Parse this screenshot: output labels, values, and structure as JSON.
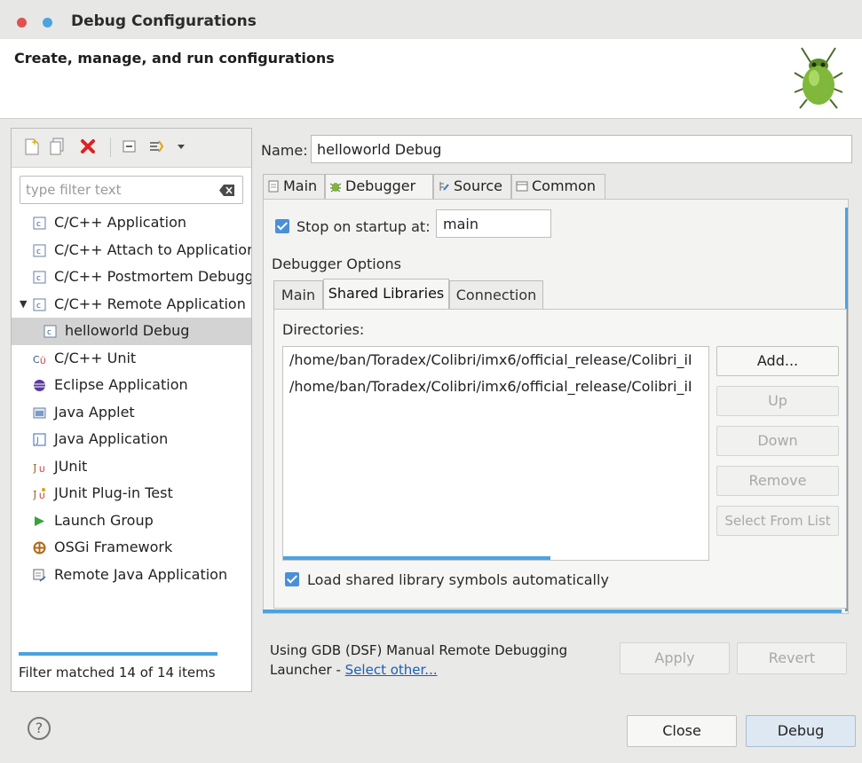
{
  "window": {
    "title": "Debug Configurations",
    "header": "Create, manage, and run configurations"
  },
  "toolbar": {
    "icons": [
      "new-config-icon",
      "duplicate-icon",
      "delete-icon",
      "collapse-all-icon",
      "filter-icon",
      "dropdown-icon"
    ]
  },
  "filter": {
    "placeholder": "type filter text",
    "status": "Filter matched 14 of 14 items"
  },
  "tree": [
    {
      "label": "C/C++ Application",
      "icon": "c-app-icon"
    },
    {
      "label": "C/C++ Attach to Applicatior",
      "icon": "c-app-icon"
    },
    {
      "label": "C/C++ Postmortem Debugg",
      "icon": "c-app-icon"
    },
    {
      "label": "C/C++ Remote Application",
      "icon": "c-app-icon",
      "expanded": true
    },
    {
      "label": "helloworld Debug",
      "icon": "c-app-icon",
      "child": true,
      "selected": true
    },
    {
      "label": "C/C++ Unit",
      "icon": "c-unit-icon"
    },
    {
      "label": "Eclipse Application",
      "icon": "eclipse-icon"
    },
    {
      "label": "Java Applet",
      "icon": "java-applet-icon"
    },
    {
      "label": "Java Application",
      "icon": "java-app-icon"
    },
    {
      "label": "JUnit",
      "icon": "junit-icon"
    },
    {
      "label": "JUnit Plug-in Test",
      "icon": "junit-plugin-icon"
    },
    {
      "label": "Launch Group",
      "icon": "launch-group-icon"
    },
    {
      "label": "OSGi Framework",
      "icon": "osgi-icon"
    },
    {
      "label": "Remote Java Application",
      "icon": "remote-java-icon"
    }
  ],
  "config": {
    "name_label": "Name:",
    "name_value": "helloworld Debug",
    "tabs": [
      {
        "label": "Main",
        "icon": "main-tab-icon"
      },
      {
        "label": "Debugger",
        "icon": "debugger-tab-icon",
        "active": true
      },
      {
        "label": "Source",
        "icon": "source-tab-icon"
      },
      {
        "label": "Common",
        "icon": "common-tab-icon"
      }
    ],
    "stop_on_startup_label": "Stop on startup at:",
    "stop_on_startup_checked": true,
    "stop_on_startup_value": "main",
    "debugger_options_label": "Debugger Options",
    "subtabs": [
      {
        "label": "Main"
      },
      {
        "label": "Shared Libraries",
        "active": true
      },
      {
        "label": "Connection"
      }
    ],
    "directories_label": "Directories:",
    "directories": [
      "/home/ban/Toradex/Colibri/imx6/official_release/Colibri_iI",
      "/home/ban/Toradex/Colibri/imx6/official_release/Colibri_iI"
    ],
    "dir_buttons": {
      "add": "Add...",
      "up": "Up",
      "down": "Down",
      "remove": "Remove",
      "select_from_list": "Select From List"
    },
    "load_symbols_label": "Load shared library symbols automatically",
    "load_symbols_checked": true,
    "launcher_text": "Using GDB (DSF) Manual Remote Debugging",
    "launcher_prefix": "Launcher - ",
    "launcher_link": "Select other...",
    "apply": "Apply",
    "revert": "Revert"
  },
  "footer": {
    "help": "?",
    "close": "Close",
    "debug": "Debug"
  },
  "colors": {
    "accent": "#4aa3df",
    "checkbox": "#4a90d9",
    "link": "#1a5fb4"
  }
}
